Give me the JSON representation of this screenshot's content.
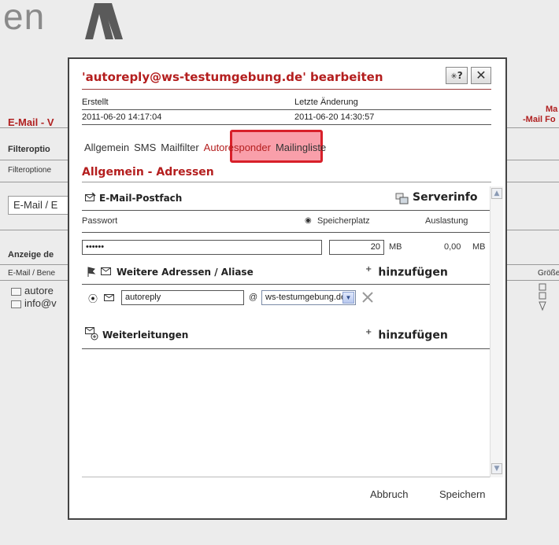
{
  "background": {
    "logo_text": "en",
    "title_left": "E-Mail - V",
    "title_right_1": "Ma",
    "title_right_2": "-Mail Fo",
    "filter_heading": "Filteroptio",
    "filter_sub": "Filteroptione",
    "select_value": "E-Mail / E",
    "display_heading": "Anzeige de",
    "column_email": "E-Mail / Bene",
    "column_size": "Größe",
    "mail_rows": [
      "autore",
      "info@v"
    ]
  },
  "dialog": {
    "title": "'autoreply@ws-testumgebung.de' bearbeiten",
    "help_label": "?",
    "close_label": "✕",
    "meta": {
      "created_label": "Erstellt",
      "modified_label": "Letzte Änderung",
      "created_value": "2011-06-20 14:17:04",
      "modified_value": "2011-06-20 14:30:57"
    },
    "tabs": [
      {
        "label": "Allgemein"
      },
      {
        "label": "SMS"
      },
      {
        "label": "Mailfilter"
      },
      {
        "label": "Autoresponder"
      },
      {
        "label": "Mailingliste"
      }
    ],
    "section_title": "Allgemein - Adressen",
    "mailbox": {
      "heading": "E-Mail-Postfach",
      "serverinfo_label": "Serverinfo",
      "password_label": "Passwort",
      "storage_label": "Speicherplatz",
      "usage_label": "Auslastung",
      "password_value": "••••••",
      "storage_value": "20",
      "storage_unit": "MB",
      "usage_value": "0,00",
      "usage_unit": "MB"
    },
    "aliases": {
      "heading": "Weitere Adressen / Aliase",
      "add_label": "hinzufügen",
      "local_part": "autoreply",
      "at_sign": "@",
      "domain": "ws-testumgebung.de"
    },
    "forwards": {
      "heading": "Weiterleitungen",
      "add_label": "hinzufügen"
    },
    "cancel_label": "Abbruch",
    "save_label": "Speichern"
  },
  "colors": {
    "accent": "#b41e1e",
    "highlight": "#d8202a"
  }
}
